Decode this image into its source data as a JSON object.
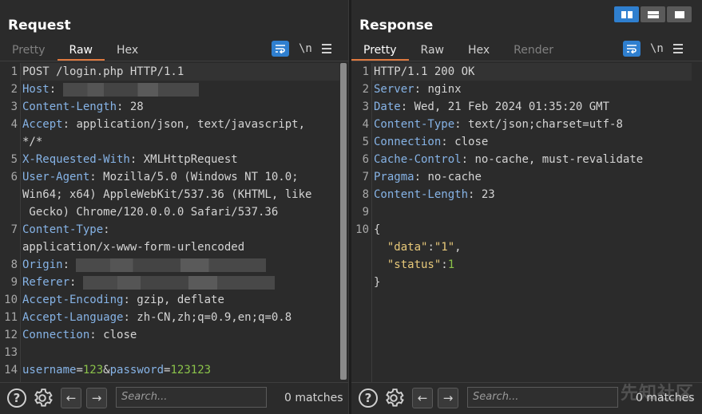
{
  "request": {
    "title": "Request",
    "tabs": [
      {
        "label": "Pretty"
      },
      {
        "label": "Raw"
      },
      {
        "label": "Hex"
      }
    ],
    "newline_label": "\\n",
    "lines": [
      {
        "n": "1",
        "name": "POST /login.php HTTP/1.1",
        "value": ""
      },
      {
        "n": "2",
        "name": "Host",
        "value": ""
      },
      {
        "n": "3",
        "name": "Content-Length",
        "value": "28"
      },
      {
        "n": "4",
        "name": "Accept",
        "value": "application/json, text/javascript,",
        "cont": "*/*"
      },
      {
        "n": "5",
        "name": "X-Requested-With",
        "value": "XMLHttpRequest"
      },
      {
        "n": "6",
        "name": "User-Agent",
        "value": "Mozilla/5.0 (Windows NT 10.0;",
        "cont": "Win64; x64) AppleWebKit/537.36 (KHTML, like",
        "cont2": " Gecko) Chrome/120.0.0.0 Safari/537.36"
      },
      {
        "n": "7",
        "name": "Content-Type",
        "value": "",
        "cont": "application/x-www-form-urlencoded"
      },
      {
        "n": "8",
        "name": "Origin",
        "value": ""
      },
      {
        "n": "9",
        "name": "Referer",
        "value": ""
      },
      {
        "n": "10",
        "name": "Accept-Encoding",
        "value": "gzip, deflate"
      },
      {
        "n": "11",
        "name": "Accept-Language",
        "value": "zh-CN,zh;q=0.9,en;q=0.8"
      },
      {
        "n": "12",
        "name": "Connection",
        "value": "close"
      },
      {
        "n": "13",
        "name": "",
        "value": ""
      },
      {
        "n": "14",
        "name": "",
        "value": ""
      }
    ],
    "body": {
      "k1": "username",
      "v1": "123",
      "amp": "&",
      "k2": "password",
      "v2": "123123"
    },
    "footer": {
      "help": "?",
      "search_placeholder": "Search...",
      "matches": "0 matches"
    }
  },
  "response": {
    "title": "Response",
    "tabs": [
      {
        "label": "Pretty"
      },
      {
        "label": "Raw"
      },
      {
        "label": "Hex"
      },
      {
        "label": "Render"
      }
    ],
    "newline_label": "\\n",
    "lines": [
      {
        "n": "1",
        "name": "HTTP/1.1 200 OK",
        "value": ""
      },
      {
        "n": "2",
        "name": "Server",
        "value": "nginx"
      },
      {
        "n": "3",
        "name": "Date",
        "value": "Wed, 21 Feb 2024 01:35:20 GMT"
      },
      {
        "n": "4",
        "name": "Content-Type",
        "value": "text/json;charset=utf-8"
      },
      {
        "n": "5",
        "name": "Connection",
        "value": "close"
      },
      {
        "n": "6",
        "name": "Cache-Control",
        "value": "no-cache, must-revalidate"
      },
      {
        "n": "7",
        "name": "Pragma",
        "value": "no-cache"
      },
      {
        "n": "8",
        "name": "Content-Length",
        "value": "23"
      },
      {
        "n": "9",
        "name": "",
        "value": ""
      },
      {
        "n": "10",
        "name": "",
        "value": ""
      }
    ],
    "json": {
      "open": "{",
      "k1": "\"data\"",
      "v1": "\"1\"",
      "k2": "\"status\"",
      "v2": "1",
      "close": "}"
    },
    "footer": {
      "help": "?",
      "search_placeholder": "Search...",
      "matches": "0 matches"
    }
  },
  "watermark": "先知社区"
}
